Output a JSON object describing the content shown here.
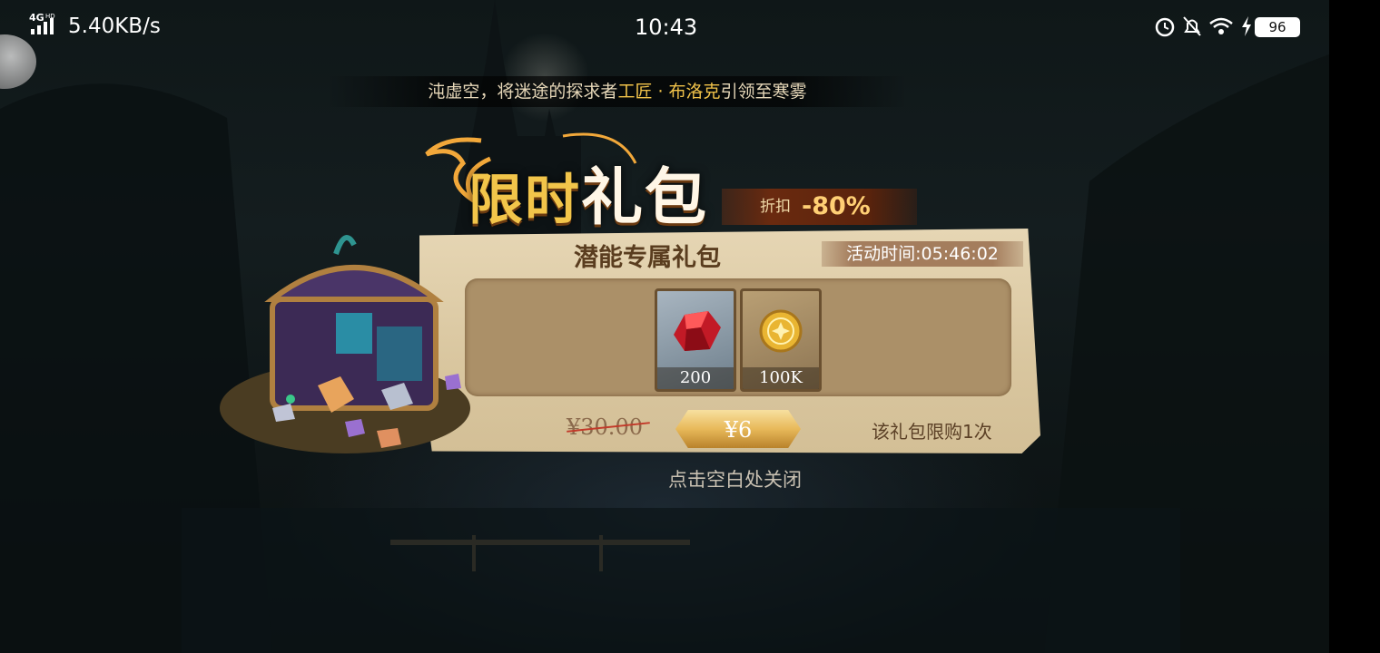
{
  "status_bar": {
    "network": "4G HD",
    "speed": "5.40KB/s",
    "time": "10:43",
    "battery": "96",
    "icons": [
      "signal-icon",
      "alarm-icon",
      "bell-off-icon",
      "wifi-icon",
      "charging-icon",
      "battery-icon"
    ]
  },
  "ticker": {
    "prefix": "沌虚空，将迷途的探求者",
    "highlight": "工匠 · 布洛克",
    "suffix": "引领至寒雾"
  },
  "popup": {
    "title_part1": "限时",
    "title_part2": "礼包",
    "discount_label": "折扣",
    "discount_value": "-80%",
    "pack_name": "潜能专属礼包",
    "timer_label": "活动时间:",
    "timer_value": "05:46:02",
    "items": [
      {
        "name": "ruby-gem",
        "quantity": "200"
      },
      {
        "name": "gold-coin",
        "quantity": "100K"
      }
    ],
    "original_price": "¥30.00",
    "buy_label": "¥6",
    "limit_text": "该礼包限购1次",
    "close_hint": "点击空白处关闭"
  },
  "colors": {
    "gold": "#f2c54a",
    "parchment": "#e6d6b4",
    "strike_red": "#c23a2a"
  }
}
